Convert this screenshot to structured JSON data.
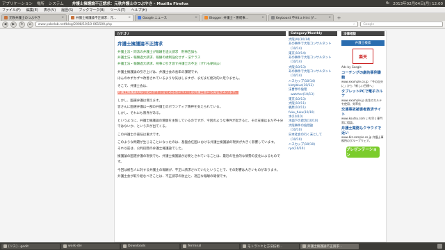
{
  "topbar": {
    "menus": [
      "アプリケーション",
      "場所",
      "システム"
    ],
    "window_title": "弁護士擁護論不正請求：元秩弁護士のつぶやき - Mozilla Firefox",
    "clock": "2013年02月04日(月) 12:00",
    "user": "fk"
  },
  "firefox_menu": [
    "ファイル(F)",
    "編集(E)",
    "表示(V)",
    "履歴(S)",
    "ブックマーク(B)",
    "ツール(T)",
    "ヘルプ(H)"
  ],
  "tabs": [
    {
      "label": "元秩弁護士のつぶやき",
      "color": "#c7733c"
    },
    {
      "label": "弁護士擁護論不正請求：元...",
      "color": "#c7733c",
      "active": true
    },
    {
      "label": "Google ニュース",
      "color": "#4a7de0"
    },
    {
      "label": "Blogger: 弁護士・懲戒事...",
      "color": "#f18a2a"
    },
    {
      "label": "Keyboard 不Hit a Hint が...",
      "color": "#888888"
    }
  ],
  "navbar": {
    "url": "www.yabelab.net/blog/2008/10/10-061500.php",
    "search_placeholder": "Google"
  },
  "article": {
    "header": "カテゴリ",
    "title": "弁護士擁護論不正請求",
    "category_lines": [
      "弁護士法・同法の弁護士が報酬を過大請求　刑事告訴も",
      "弁護士法・報酬過大請求、報酬の規制強化せず・法テラス",
      "弁護士法・報酬過大請求、刑事に引き渡す弁護士の不正（ずれも朝日jp）"
    ],
    "paragraphs": [
      "弁護士擁護論の引き上げは、弁護士会の長年の課題です。",
      "ほんのわずかずつ改善されているような気はしますが、まだまだ絶対的に足りません。",
      "そこで、弁護士会は、",
      "弁護士擁護論の取り組みが不十分である点については弁護士会にも責任があります。",
      "しかし、国選弁護は増えます。",
      "皆さんに国選弁護は一部の弁護士のボランティア精神を支えられている。",
      "しかし、それにも限界がある。",
      "というように、弁護士擁護論の増額を主張しているのですが、今回のような事件が起きると、その支援はまだ不十分ではないか、という声が出てくる。",
      "この弁護士の責任は重大です。",
      "このような問題が生じることになったのは、基盤会任国における弁護士擁護論の現状が大きく影響しています。",
      "それ以前は、公判段階の弁護士擁護論でした。",
      "擁護論の国選弁護の現状でも、弁護士擁護論が必要とされていることは、最近の社会的な情勢の変化によるものです。",
      "今回は被告人に対する弁護士の報酬が、不正に請求されていたということで、その影響は大きいものがあります。",
      "弁護士会が取り組むべきことは、不正請求の防止と、適正な報酬の確保です。"
    ],
    "highlight_index": 3
  },
  "sidebar_left": {
    "header": "Category/Monthly",
    "items": [
      {
        "label": "大阪(A)",
        "count": "(10/14)"
      },
      {
        "label": "あの事件で大阪コンサルタント",
        "count": "(10/14)"
      },
      {
        "label": "東京(10/14)",
        "count": ""
      },
      {
        "label": "あの事件で大阪コンサルタント",
        "count": "(10/14)"
      },
      {
        "label": "大阪(10/13)",
        "count": ""
      },
      {
        "label": "あの事件で大阪コンサルタント",
        "count": "(10/14)"
      },
      {
        "label": "ハスカップ(10/14)",
        "count": ""
      },
      {
        "label": "kistyblue(10/13)",
        "count": ""
      },
      {
        "label": "法曹界の倫理",
        "count": "watcher(10/13)"
      },
      {
        "label": "東京(10/13)",
        "count": ""
      },
      {
        "label": "大阪(10/11)",
        "count": ""
      },
      {
        "label": "梶原(10/11)",
        "count": ""
      },
      {
        "label": "fuku_fuku(10/10)",
        "count": ""
      },
      {
        "label": "水(10/10)",
        "count": ""
      },
      {
        "label": "水面下の政治(10/10)",
        "count": ""
      },
      {
        "label": "大阪事件の倫理論",
        "count": "(10/10)"
      },
      {
        "label": "日本社会の行く末として",
        "count": "(10/10)"
      },
      {
        "label": "ハスカップ(10/10)",
        "count": ""
      },
      {
        "label": "ryo(10/10)",
        "count": ""
      }
    ]
  },
  "sidebar_right": {
    "header": "法律相談",
    "button": "弁護士検索",
    "ad_logo": "楽天",
    "ad_by": "Ads by Google",
    "links": [
      {
        "title": "コーチングの劇的事例書籍",
        "sub": "www.example.co.jp 「今の自分に」から「新しい目標へ」"
      },
      {
        "title": "タブレットPCで電子カルテ",
        "sub": "www.example.jp 先生のカルテを使用、効率化"
      },
      {
        "title": "交通事故被害者救済サイト",
        "sub": "www.koutsu.com いち早く専門家に相談。"
      },
      {
        "title": "弁護士業務もクラウドで近い",
        "sub": "www.biz-sample.co.jp 弁護士事務所のグループウェア。"
      }
    ],
    "bottom_logo": "プレゼンテーション"
  },
  "taskbar": [
    {
      "label": "[リス] - gedit"
    },
    {
      "label": "work-div"
    },
    {
      "label": "Downloads"
    },
    {
      "label": "Terminal"
    },
    {
      "label": "モトランヒと方法技術..."
    },
    {
      "label": "弁護士擁護論不正請求...",
      "active": true
    }
  ]
}
